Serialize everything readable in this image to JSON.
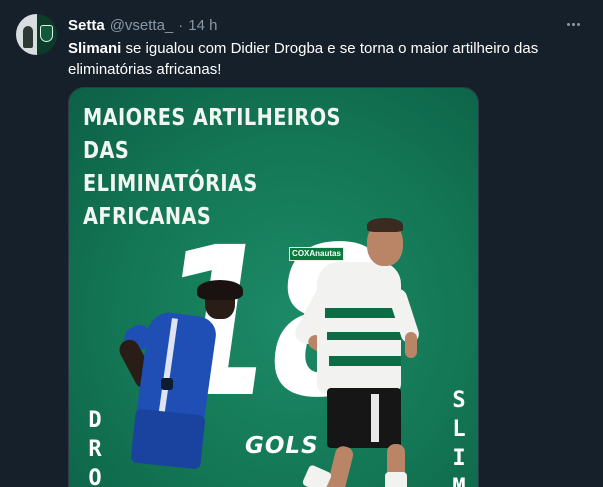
{
  "author": {
    "display_name": "Setta",
    "handle": "@vsetta_",
    "separator": "·",
    "time": "14 h"
  },
  "tweet": {
    "mention": "Slimani",
    "text_rest": " se igualou com Didier Drogba e se torna o maior artilheiro das eliminatórias africanas!"
  },
  "media": {
    "title_line1": "MAIORES ARTILHEIROS DAS",
    "title_line2": "ELIMINATÓRIAS AFRICANAS",
    "big_number": "18",
    "goals_label": "GOLS",
    "brand_label": "COXAnautas",
    "name_left_letters": [
      "D",
      "R",
      "O"
    ],
    "name_right_letters": [
      "S",
      "L",
      "I",
      "M"
    ]
  },
  "colors": {
    "background": "#15202b",
    "card_green": "#137654",
    "muted_text": "#8899a6"
  },
  "icons": {
    "more": "more-horizontal-icon"
  }
}
